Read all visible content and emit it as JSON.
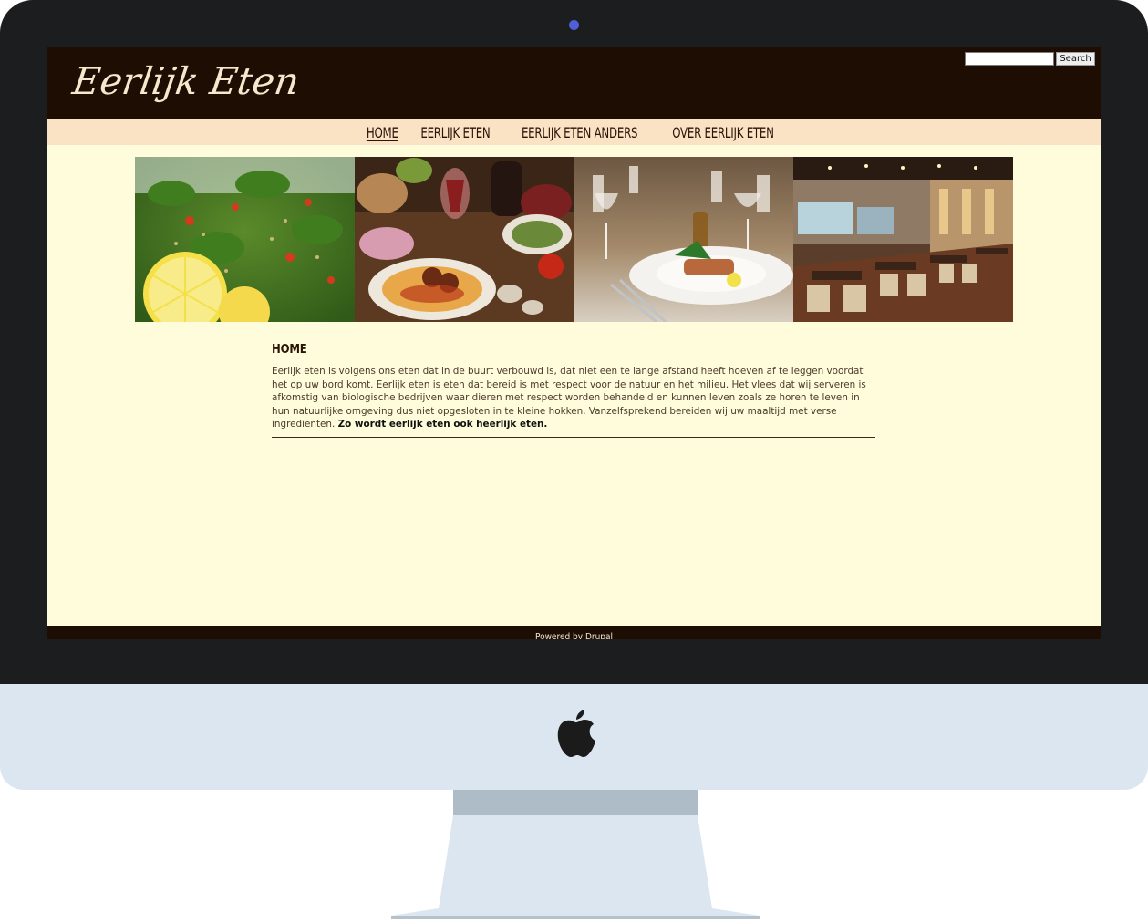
{
  "site": {
    "logo_text": "Eerlijk Eten",
    "search_button": "Search",
    "search_value": ""
  },
  "nav": {
    "items": [
      {
        "label": "HOME",
        "active": true
      },
      {
        "label": "EERLIJK ETEN",
        "active": false
      },
      {
        "label": "EERLIJK ETEN ANDERS",
        "active": false
      },
      {
        "label": "OVER EERLIJK ETEN",
        "active": false
      }
    ]
  },
  "banner": {
    "images": [
      "tabbouleh-salad-photo",
      "italian-food-photo",
      "plated-dish-photo",
      "restaurant-interior-photo"
    ]
  },
  "content": {
    "title": "HOME",
    "body": "Eerlijk eten is volgens ons eten dat in de buurt verbouwd is, dat niet een te lange afstand heeft hoeven af te leggen voordat het op uw bord komt. Eerlijk eten is eten dat bereid is met respect voor de natuur en het milieu. Het vlees dat wij serveren is afkomstig van biologische bedrijven waar dieren met respect worden behandeld en kunnen leven zoals ze horen te leven in hun natuurlijke omgeving dus niet opgesloten in te kleine hokken. Vanzelfsprekend bereiden wij uw maaltijd met verse ingredienten.",
    "body_bold": "Zo wordt eerlijk eten ook heerlijk eten."
  },
  "footer": {
    "text": "Powered by Drupal"
  },
  "colors": {
    "header": "#1e0d02",
    "nav": "#fae2c4",
    "background": "#fffcdb"
  }
}
